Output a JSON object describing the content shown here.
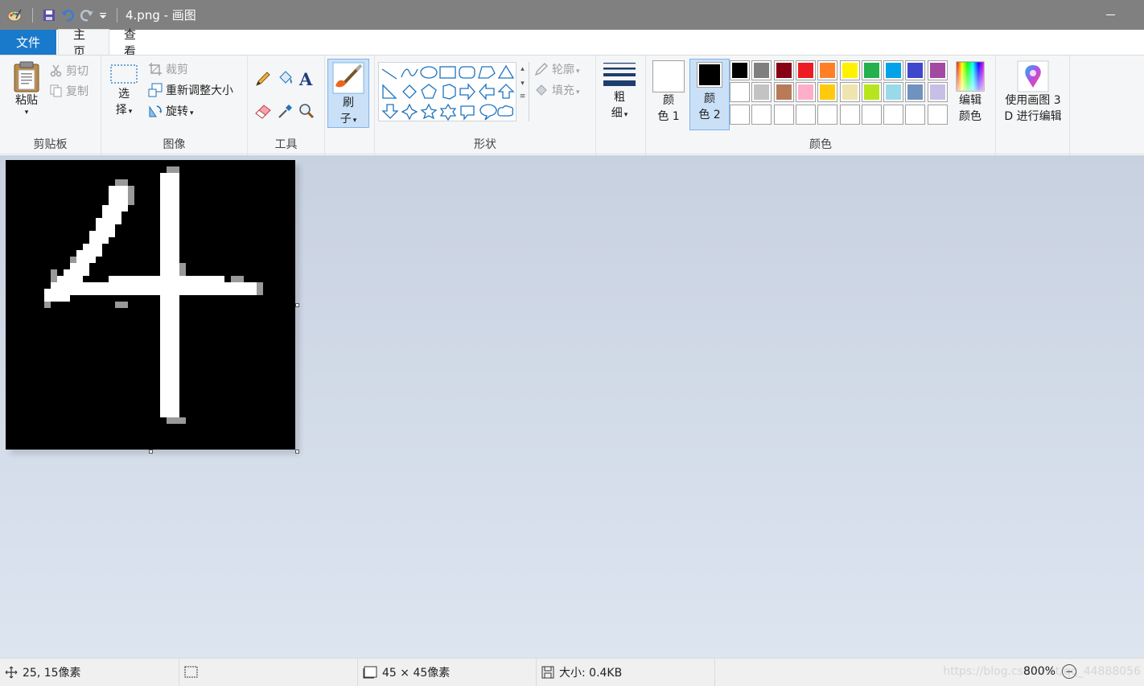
{
  "window": {
    "title": "4.png - 画图"
  },
  "tabs": {
    "file": "文件",
    "home": "主页",
    "view": "查看"
  },
  "clipboard": {
    "paste": "粘贴",
    "cut": "剪切",
    "copy": "复制",
    "group": "剪贴板"
  },
  "image": {
    "select_1": "选",
    "select_2": "择",
    "crop": "裁剪",
    "resize": "重新调整大小",
    "rotate": "旋转",
    "group": "图像"
  },
  "tools": {
    "group": "工具"
  },
  "brushes": {
    "label_1": "刷",
    "label_2": "子"
  },
  "shapes": {
    "outline": "轮廓",
    "fill": "填充",
    "group": "形状"
  },
  "size": {
    "label_1": "粗",
    "label_2": "细"
  },
  "colors": {
    "color1_1": "颜",
    "color1_2": "色 1",
    "color2_1": "颜",
    "color2_2": "色 2",
    "edit_1": "编辑",
    "edit_2": "颜色",
    "group": "颜色",
    "color1_value": "#ffffff",
    "color2_value": "#000000",
    "palette_row1": [
      "#000000",
      "#7f7f7f",
      "#880015",
      "#ed1c24",
      "#ff7f27",
      "#fff200",
      "#22b14c",
      "#00a2e8",
      "#3f48cc",
      "#a349a4"
    ],
    "palette_row2": [
      "#ffffff",
      "#c3c3c3",
      "#b97a57",
      "#ffaec9",
      "#ffc90e",
      "#efe4b0",
      "#b5e61d",
      "#99d9ea",
      "#7092be",
      "#c8bfe7"
    ],
    "palette_row3": [
      "#ffffff",
      "#ffffff",
      "#ffffff",
      "#ffffff",
      "#ffffff",
      "#ffffff",
      "#ffffff",
      "#ffffff",
      "#ffffff",
      "#ffffff"
    ]
  },
  "paint3d": {
    "line_1": "使用画图 3",
    "line_2": "D 进行编辑"
  },
  "status": {
    "cursor_pos": "25, 15像素",
    "image_size": "45 × 45像素",
    "file_size": "大小: 0.4KB",
    "zoom": "800%",
    "watermark": "https://blog.csdn.net/qq_44888056"
  }
}
